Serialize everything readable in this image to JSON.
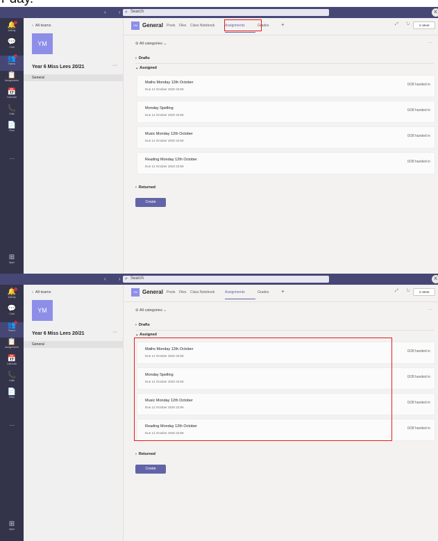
{
  "caption": "r day.",
  "screens": [
    {
      "highlight": "tab"
    },
    {
      "highlight": "assigned-section"
    }
  ],
  "ui": {
    "search": {
      "placeholder": "Search"
    },
    "user_initial": "K",
    "rail": [
      {
        "label": "Activity",
        "icon": "bell-icon",
        "glyph": "🔔",
        "badge": true
      },
      {
        "label": "Chat",
        "icon": "chat-icon",
        "glyph": "💬",
        "badge": false
      },
      {
        "label": "Teams",
        "icon": "teams-icon",
        "glyph": "👥",
        "badge": true,
        "active": true
      },
      {
        "label": "Assignments",
        "icon": "assignments-icon",
        "glyph": "📋",
        "badge": false
      },
      {
        "label": "Calendar",
        "icon": "calendar-icon",
        "glyph": "📅",
        "badge": false
      },
      {
        "label": "Calls",
        "icon": "phone-icon",
        "glyph": "📞",
        "badge": false
      },
      {
        "label": "Files",
        "icon": "file-icon",
        "glyph": "📄",
        "badge": false
      }
    ],
    "rail_more": "···",
    "rail_apps": "Apps",
    "back_label": "All teams",
    "team_initials": "YM",
    "team_name": "Year 6 Miss Lees 20/21",
    "team_more": "···",
    "channel": "General",
    "channel_tile": "YM",
    "channel_name": "General",
    "tabs": [
      "Posts",
      "Files",
      "Class Notebook",
      "Assignments",
      "Grades"
    ],
    "active_tab": "Assignments",
    "meet_label": "Meet",
    "categories_label": "All categories",
    "sections": {
      "drafts": "Drafts",
      "assigned": "Assigned",
      "returned": "Returned"
    },
    "assignments": [
      {
        "title": "Maths Monday 12th October",
        "due": "Due 12 October 2020 23:59",
        "status": "0/28 handed in"
      },
      {
        "title": "Monday Spelling",
        "due": "Due 12 October 2020 23:59",
        "status": "0/28 handed in"
      },
      {
        "title": "Music Monday 12th October",
        "due": "Due 12 October 2020 23:59",
        "status": "0/28 handed in"
      },
      {
        "title": "Reading Monday 12th October",
        "due": "Due 12 October 2020 23:59",
        "status": "0/28 handed in"
      }
    ],
    "create_label": "Create",
    "colors": {
      "titlebar": "#464775",
      "rail": "#33344a",
      "accent": "#6264a7",
      "highlight": "#e21b1b",
      "team_tile": "#8d8ee8"
    }
  }
}
